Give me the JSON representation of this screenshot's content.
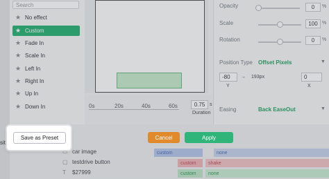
{
  "presets": {
    "search_placeholder": "Search",
    "items": [
      {
        "label": "No effect",
        "selected": false
      },
      {
        "label": "Custom",
        "selected": true
      },
      {
        "label": "Fade In",
        "selected": false
      },
      {
        "label": "Scale In",
        "selected": false
      },
      {
        "label": "Left In",
        "selected": false
      },
      {
        "label": "Right In",
        "selected": false
      },
      {
        "label": "Up In",
        "selected": false
      },
      {
        "label": "Down In",
        "selected": false
      }
    ]
  },
  "timeline": {
    "ticks": [
      "0s",
      "20s",
      "40s",
      "60s"
    ],
    "duration_value": "0.75",
    "duration_unit": "s",
    "duration_label": "Duration"
  },
  "properties": {
    "opacity_label": "Opacity",
    "opacity_value": "0",
    "scale_label": "Scale",
    "scale_value": "100",
    "rotation_label": "Rotation",
    "rotation_value": "0",
    "percent_unit": "%",
    "position_type_label": "Position Type",
    "position_type_value": "Offset Pixels",
    "y_input_value": "-80",
    "y_axis_label": "Y",
    "y_pixels": "193px",
    "x_input_value": "0",
    "x_axis_label": "X",
    "easing_label": "Easing",
    "easing_value": "Back EaseOut"
  },
  "layers": {
    "rows": [
      {
        "label": "car image",
        "track": "custom",
        "track2": "none"
      },
      {
        "label": "testdrive button",
        "track": "custom",
        "track2": "shake"
      },
      {
        "label": "$27999",
        "track": "custom",
        "track2": "none"
      }
    ],
    "sidebar_fragment": "sit"
  },
  "actions": {
    "save_preset": "Save as Preset",
    "cancel": "Cancel",
    "apply": "Apply"
  },
  "colors": {
    "accent_green": "#2fb57a",
    "cancel_orange": "#e08a2c"
  }
}
